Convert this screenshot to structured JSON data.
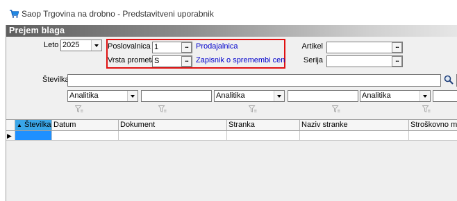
{
  "window": {
    "title": "Saop Trgovina na drobno - Predstavitveni uporabnik"
  },
  "form": {
    "title": "Prejem blaga",
    "leto": {
      "label": "Leto",
      "value": "2025"
    },
    "poslovalnica": {
      "label": "Poslovalnica",
      "value": "1",
      "description": "Prodajalnica"
    },
    "vrsta_prometa": {
      "label": "Vrsta prometa",
      "value": "S",
      "description": "Zapisnik o spremembi cen"
    },
    "artikel": {
      "label": "Artikel",
      "value": ""
    },
    "serija": {
      "label": "Serija",
      "value": ""
    },
    "stevilka": {
      "label": "Številka",
      "value": ""
    },
    "filters": [
      {
        "select": "Analitika",
        "value": ""
      },
      {
        "select": "Analitika",
        "value": ""
      },
      {
        "select": "Analitika",
        "value": ""
      }
    ],
    "dots_label": "..."
  },
  "grid": {
    "columns": [
      "Številka",
      "Datum",
      "Dokument",
      "Stranka",
      "Naziv stranke",
      "Stroškovno mest"
    ],
    "sort_indicator": "▲",
    "row_indicator": "▶"
  }
}
